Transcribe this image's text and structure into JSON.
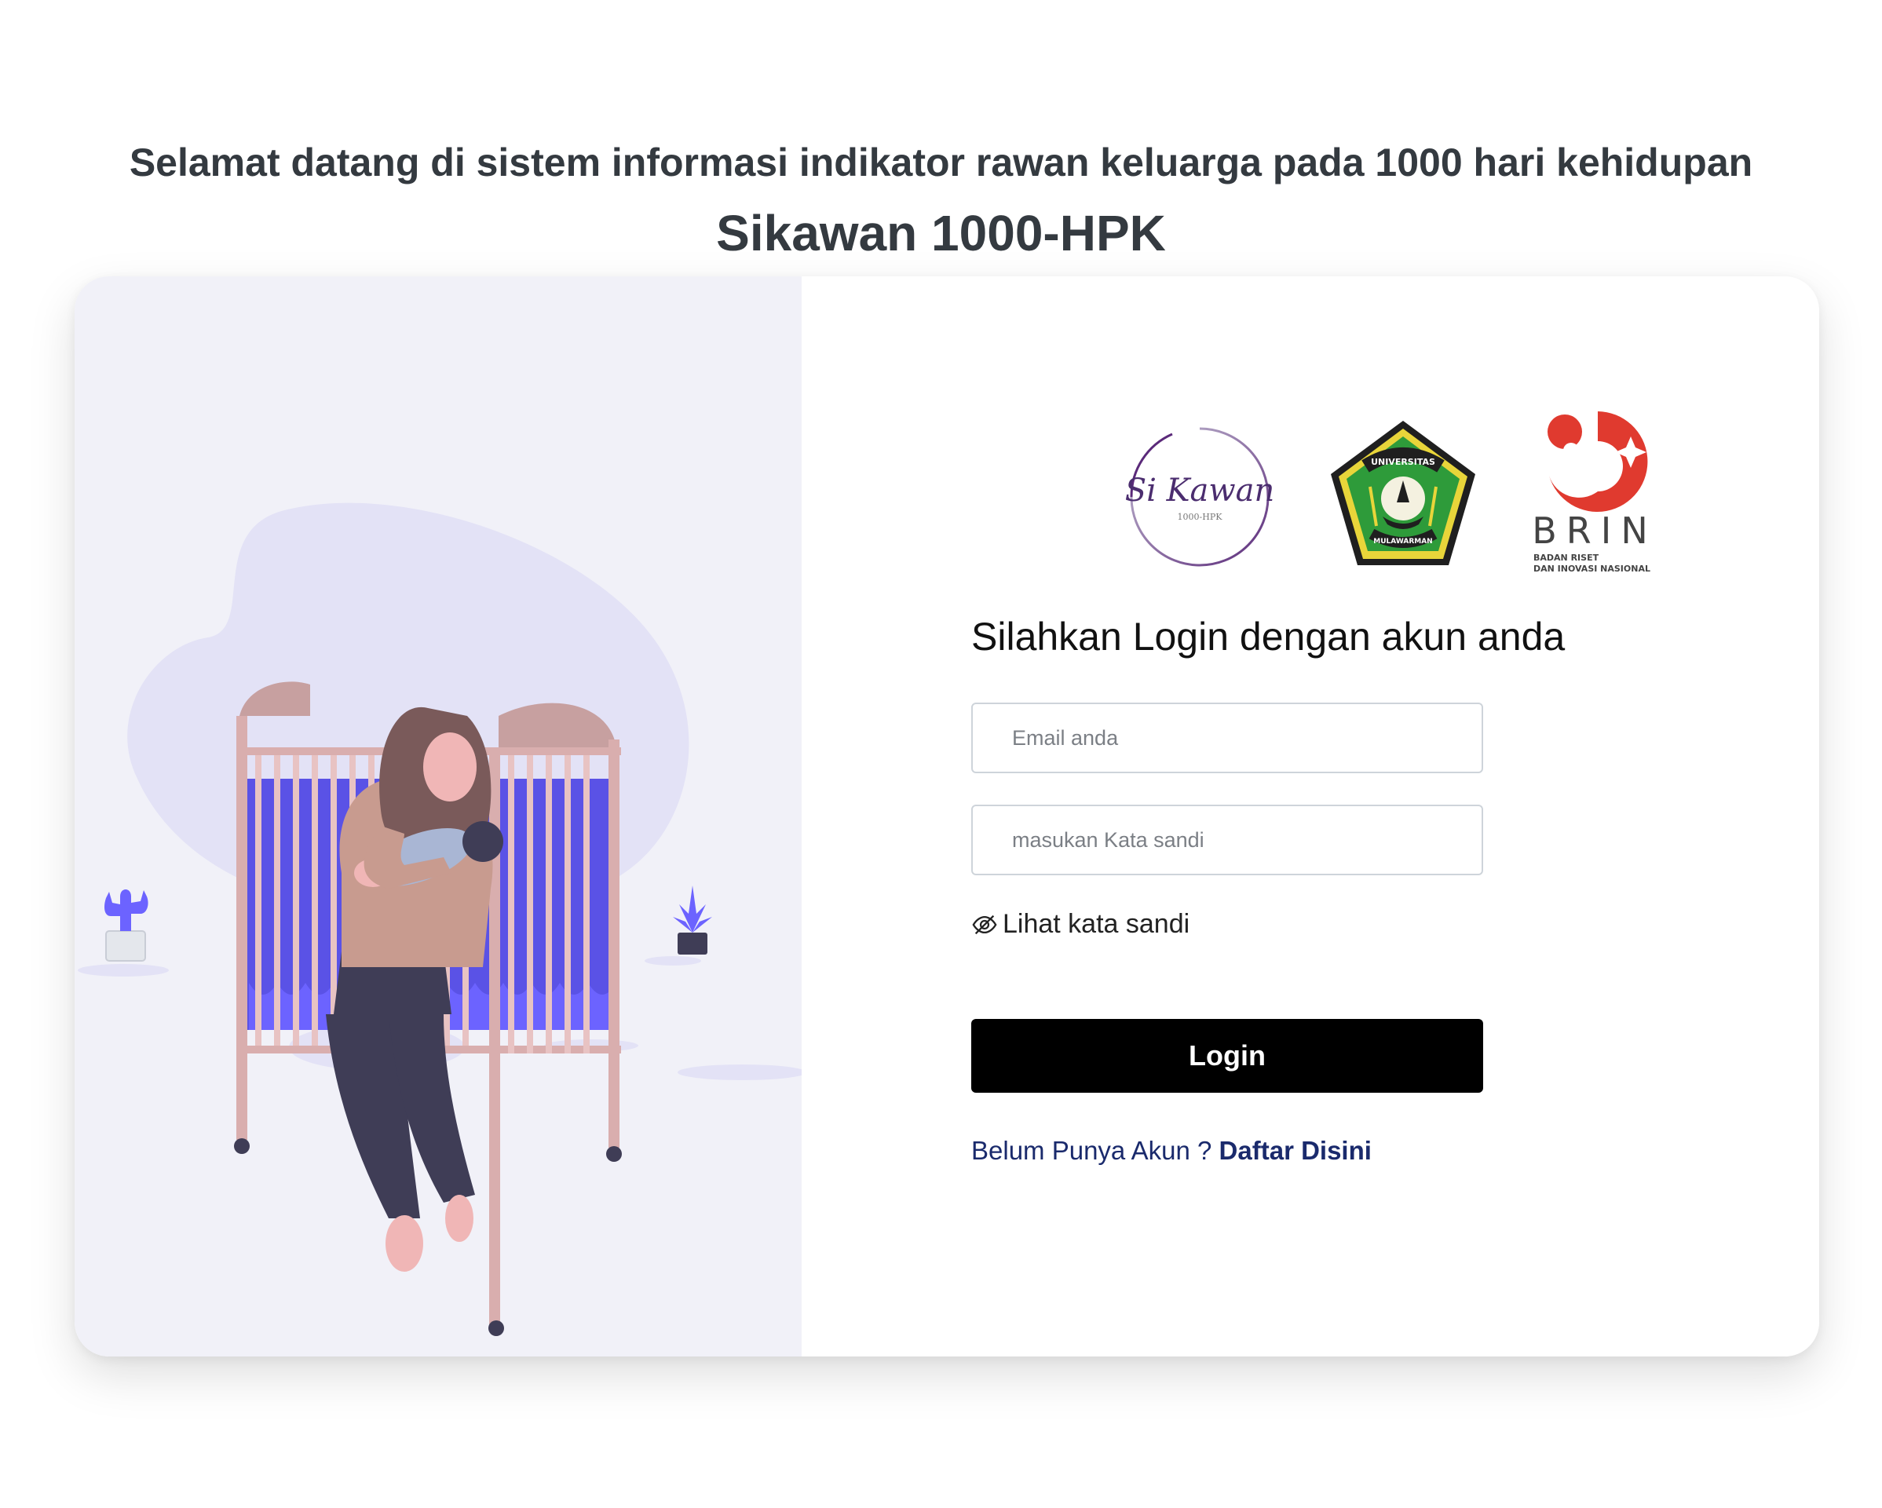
{
  "header": {
    "welcome_text": "Selamat datang di sistem informasi indikator rawan keluarga pada 1000 hari kehidupan",
    "app_title": "Sikawan 1000-HPK"
  },
  "logos": {
    "sikawan": {
      "name": "Si Kawan",
      "subtitle": "1000-HPK"
    },
    "unmul": {
      "top_text": "UNIVERSITAS",
      "bottom_text": "MULAWARMAN"
    },
    "brin": {
      "name": "BRIN",
      "line1": "BADAN RISET",
      "line2": "DAN INOVASI NASIONAL"
    }
  },
  "login": {
    "heading": "Silahkan Login dengan akun anda",
    "email_placeholder": "Email anda",
    "email_value": "",
    "password_placeholder": "masukan Kata sandi",
    "password_value": "",
    "show_password_label": "Lihat kata sandi",
    "submit_label": "Login",
    "register_prompt": "Belum Punya Akun ?",
    "register_link": "Daftar Disini"
  },
  "icons": {
    "show_password": "eye-slash-icon"
  },
  "colors": {
    "heading_text": "#343a40",
    "left_panel_bg": "#f1f1f8",
    "button_bg": "#000000",
    "link_color": "#1a2a6c",
    "illustration_accent": "#6c63ff",
    "brin_red": "#e03a2f",
    "unmul_green": "#2e9b3a"
  }
}
